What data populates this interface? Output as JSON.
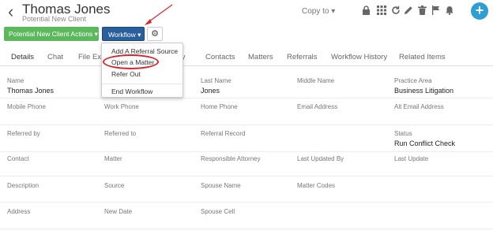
{
  "header": {
    "client_name": "Thomas Jones",
    "client_status": "Potential New Client",
    "copy_to": "Copy to ▾"
  },
  "toolbar": {
    "actions_label": "Potential New Client Actions ▾",
    "workflow_label": "Workflow ▾"
  },
  "tabs": [
    "Details",
    "Chat",
    "File Exp",
    "ity",
    "Contacts",
    "Matters",
    "Referrals",
    "Workflow History",
    "Related Items"
  ],
  "workflow_menu": {
    "items": [
      "Add A Referral Source",
      "Open a Matter",
      "Refer Out",
      "End Workflow"
    ]
  },
  "fields": {
    "row1": [
      {
        "label": "Name",
        "value": "Thomas Jones"
      },
      {
        "label": "",
        "value": ""
      },
      {
        "label": "Last Name",
        "value": "Jones"
      },
      {
        "label": "Middle Name",
        "value": ""
      },
      {
        "label": "Practice Area",
        "value": "Business Litigation"
      }
    ],
    "row2": [
      {
        "label": "Mobile Phone",
        "value": ""
      },
      {
        "label": "Work Phone",
        "value": ""
      },
      {
        "label": "Home Phone",
        "value": ""
      },
      {
        "label": "Email Address",
        "value": ""
      },
      {
        "label": "Alt Email Address",
        "value": ""
      }
    ],
    "row3": [
      {
        "label": "Referred by",
        "value": ""
      },
      {
        "label": "Referred to",
        "value": ""
      },
      {
        "label": "Referral Record",
        "value": ""
      },
      {
        "label": "",
        "value": ""
      },
      {
        "label": "Status",
        "value": "Run Conflict Check"
      }
    ],
    "row4": [
      {
        "label": "Contact",
        "value": ""
      },
      {
        "label": "Matter",
        "value": ""
      },
      {
        "label": "Responsible Attorney",
        "value": ""
      },
      {
        "label": "Last Updated By",
        "value": ""
      },
      {
        "label": "Last Update",
        "value": ""
      }
    ],
    "row5": [
      {
        "label": "Description",
        "value": ""
      },
      {
        "label": "Source",
        "value": ""
      },
      {
        "label": "Spouse Name",
        "value": ""
      },
      {
        "label": "Matter Codes",
        "value": ""
      },
      {
        "label": "",
        "value": ""
      }
    ],
    "row6": [
      {
        "label": "Address",
        "value": ""
      },
      {
        "label": "New Date",
        "value": ""
      },
      {
        "label": "Spouse Cell",
        "value": ""
      },
      {
        "label": "",
        "value": ""
      },
      {
        "label": "",
        "value": ""
      }
    ]
  },
  "colors": {
    "green_button": "#5cb85c",
    "blue_button": "#2a5f9e",
    "plus_button": "#2f9fd3",
    "highlight": "#d9262c"
  }
}
